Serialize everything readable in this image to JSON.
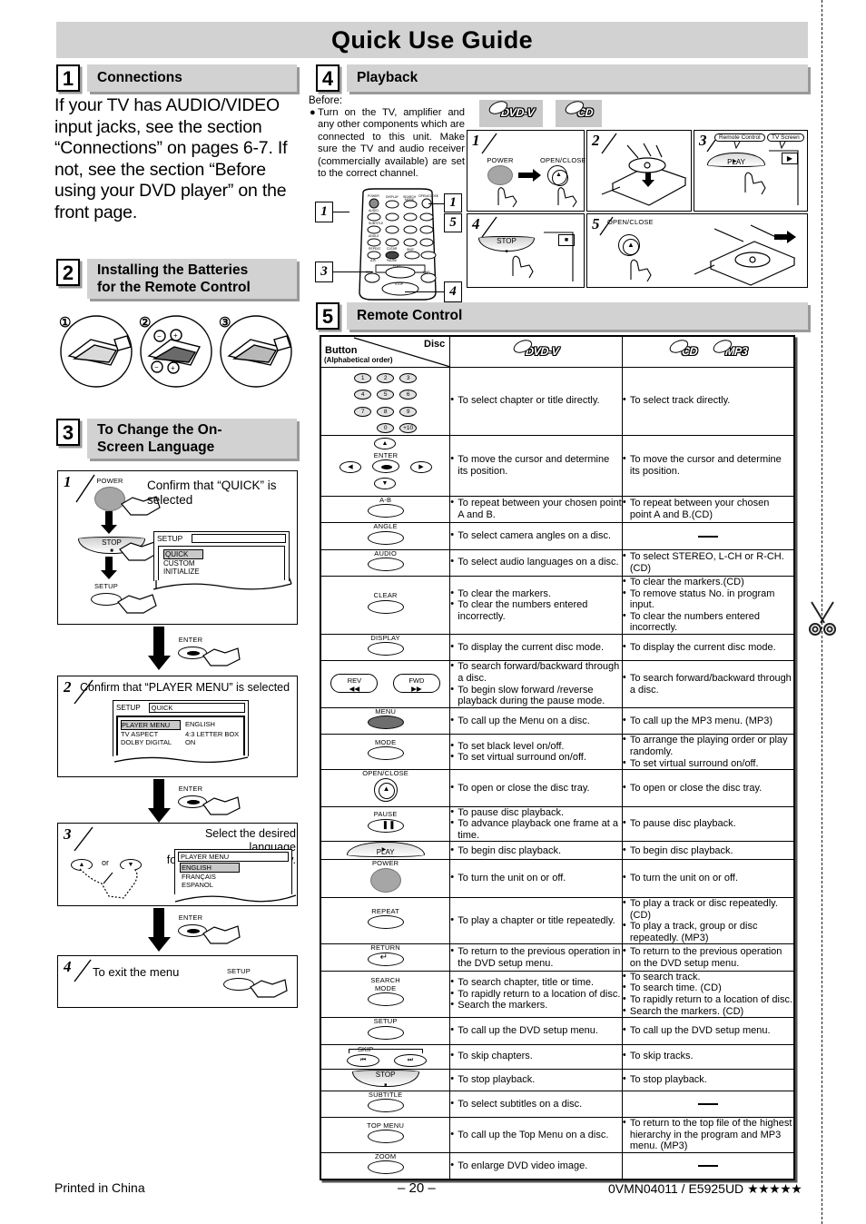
{
  "document": {
    "title": "Quick Use Guide",
    "footer": {
      "printed": "Printed in China",
      "page_number": "– 20 –",
      "part_number": "0VMN04011 / E5925UD",
      "stars": "★★★★★"
    }
  },
  "sections": {
    "connections": {
      "number": "1",
      "title": "Connections",
      "body": "If your TV has AUDIO/VIDEO input jacks, see the section “Connections” on pages 6-7. If not, see the section “Before using your DVD player” on the front page."
    },
    "batteries": {
      "number": "2",
      "title_line1": "Installing the Batteries",
      "title_line2": "for the Remote Control",
      "steps": [
        "①",
        "②",
        "③"
      ],
      "polarity": [
        "−",
        "+",
        "−",
        "+"
      ]
    },
    "language": {
      "number": "3",
      "title_line1": "To Change the On-",
      "title_line2": "Screen Language",
      "step1": {
        "num": "1",
        "instruction": "Confirm that “QUICK” is selected",
        "buttons": [
          "POWER",
          "STOP",
          "SETUP"
        ],
        "osd": {
          "header_left": "SETUP",
          "header_right": "",
          "items": [
            "QUICK",
            "CUSTOM",
            "INITIALIZE"
          ],
          "selected": "QUICK"
        }
      },
      "connector1_button": "ENTER",
      "step2": {
        "num": "2",
        "instruction": "Confirm that “PLAYER MENU” is selected",
        "osd": {
          "header_left": "SETUP",
          "header_right": "QUICK",
          "rows": [
            {
              "name": "PLAYER MENU",
              "value": "ENGLISH"
            },
            {
              "name": "TV ASPECT",
              "value": "4:3 LETTER BOX"
            },
            {
              "name": "DOLBY DIGITAL",
              "value": "ON"
            }
          ],
          "selected": "PLAYER MENU"
        }
      },
      "connector2_button": "ENTER",
      "step3": {
        "num": "3",
        "instruction_line1": "Select the desired language",
        "instruction_line2": "for the On-screen display.",
        "or_label": "or",
        "osd": {
          "header": "PLAYER MENU",
          "items": [
            "ENGLISH",
            "FRANÇAIS",
            "ESPANOL"
          ],
          "selected": "ENGLISH"
        }
      },
      "connector3_button": "ENTER",
      "step4": {
        "num": "4",
        "instruction": "To exit the menu",
        "button": "SETUP"
      }
    },
    "playback": {
      "number": "4",
      "title": "Playback",
      "before_label": "Before:",
      "before_text": "Turn on the TV, amplifier and any other components which are connected to this unit. Make sure the TV and audio receiver (commercially available) are set to the correct channel.",
      "disc_badges": [
        "DVD-V",
        "CD"
      ],
      "remote_callouts": [
        "1",
        "1",
        "5",
        "3",
        "4"
      ],
      "remote_labels": [
        "POWER",
        "DISPLAY",
        "SEARCH MODE",
        "OPEN/CLOSE",
        "AUDIO",
        "RETURN",
        "ANGLE",
        "REPEAT",
        "CLEAR",
        "A-B",
        "PAUSE",
        "SKIP",
        "PLAY",
        "REV",
        "FWD",
        "STOP"
      ],
      "steps": [
        {
          "num": "1",
          "labels": [
            "POWER",
            "OPEN/CLOSE"
          ]
        },
        {
          "num": "2",
          "labels": []
        },
        {
          "num": "3",
          "labels": [
            "PLAY"
          ],
          "callouts": [
            "Remote Control",
            "TV Screen"
          ]
        },
        {
          "num": "4",
          "labels": [
            "STOP"
          ]
        },
        {
          "num": "5",
          "labels": [
            "OPEN/CLOSE"
          ]
        }
      ]
    },
    "remote_control": {
      "number": "5",
      "title": "Remote Control"
    }
  },
  "remote_table": {
    "header": {
      "button_label": "Button",
      "button_sub": "(Alphabetical order)",
      "disc_label": "Disc",
      "col_dvd": "DVD-V",
      "col_cd": "CD",
      "col_mp3": "MP3"
    },
    "rows": [
      {
        "button": "numbers",
        "keys": [
          "1",
          "2",
          "3",
          "4",
          "5",
          "6",
          "7",
          "8",
          "9",
          "0",
          "+10"
        ],
        "dvd": [
          "To select chapter or title directly."
        ],
        "cd": [
          "To select track directly."
        ]
      },
      {
        "button": "cursor",
        "label": "ENTER",
        "dvd": [
          "To move the cursor and determine its position."
        ],
        "cd": [
          "To move the cursor and determine its position."
        ]
      },
      {
        "button": "A-B",
        "dvd": [
          "To repeat between your chosen point A and B."
        ],
        "cd": [
          "To repeat between your chosen point A and B.(CD)"
        ]
      },
      {
        "button": "ANGLE",
        "dvd": [
          "To select camera angles on a disc."
        ],
        "cd": null
      },
      {
        "button": "AUDIO",
        "dvd": [
          "To select audio languages on a disc."
        ],
        "cd": [
          "To select STEREO, L-CH or R-CH.(CD)"
        ]
      },
      {
        "button": "CLEAR",
        "dvd": [
          "To clear the markers.",
          "To clear the numbers entered incorrectly."
        ],
        "cd": [
          "To clear the markers.(CD)",
          "To remove status No. in program input.",
          "To clear the numbers entered incorrectly."
        ]
      },
      {
        "button": "DISPLAY",
        "dvd": [
          "To display the current disc mode."
        ],
        "cd": [
          "To display the current disc mode."
        ]
      },
      {
        "button": "REV/FWD",
        "label_left": "REV",
        "label_right": "FWD",
        "dvd": [
          "To search forward/backward through a disc.",
          "To begin slow forward /reverse playback during the pause mode."
        ],
        "cd": [
          "To search forward/backward through a disc."
        ]
      },
      {
        "button": "MENU",
        "dvd": [
          "To call up the Menu on a disc."
        ],
        "cd": [
          "To call up the MP3 menu. (MP3)"
        ]
      },
      {
        "button": "MODE",
        "dvd": [
          "To set black level on/off.",
          "To set virtual surround on/off."
        ],
        "cd": [
          "To arrange the playing order or play randomly.",
          "To set virtual surround on/off."
        ]
      },
      {
        "button": "OPEN/CLOSE",
        "dvd": [
          "To open or close the disc tray."
        ],
        "cd": [
          "To open or close the disc tray."
        ]
      },
      {
        "button": "PAUSE",
        "dvd": [
          "To pause disc playback.",
          "To advance playback one frame at a time."
        ],
        "cd": [
          "To pause disc playback."
        ]
      },
      {
        "button": "PLAY",
        "dvd": [
          "To begin disc playback."
        ],
        "cd": [
          "To begin disc playback."
        ]
      },
      {
        "button": "POWER",
        "dvd": [
          "To turn the unit on or off."
        ],
        "cd": [
          "To turn the unit on or off."
        ]
      },
      {
        "button": "REPEAT",
        "dvd": [
          "To play a chapter or title repeatedly."
        ],
        "cd": [
          "To play a track or disc repeatedly. (CD)",
          "To play a track, group or disc repeatedly. (MP3)"
        ]
      },
      {
        "button": "RETURN",
        "dvd": [
          "To return to the previous operation in the DVD setup menu."
        ],
        "cd": [
          "To return to the previous operation on the DVD setup menu."
        ]
      },
      {
        "button": "SEARCH MODE",
        "label_line1": "SEARCH",
        "label_line2": "MODE",
        "dvd": [
          "To search chapter, title or time.",
          "To rapidly return to a location of disc.",
          "Search the markers."
        ],
        "cd": [
          "To search track.",
          "To search time. (CD)",
          "To rapidly return to a location of disc.",
          "Search the markers. (CD)"
        ]
      },
      {
        "button": "SETUP",
        "dvd": [
          "To call up the DVD setup menu."
        ],
        "cd": [
          "To call up the DVD setup menu."
        ]
      },
      {
        "button": "SKIP",
        "dvd": [
          "To skip chapters."
        ],
        "cd": [
          "To skip tracks."
        ]
      },
      {
        "button": "STOP",
        "dvd": [
          "To stop playback."
        ],
        "cd": [
          "To stop playback."
        ]
      },
      {
        "button": "SUBTITLE",
        "dvd": [
          "To select subtitles on a disc."
        ],
        "cd": null
      },
      {
        "button": "TOP MENU",
        "dvd": [
          "To call up the Top Menu on a disc."
        ],
        "cd": [
          "To return to the top file of the highest hierarchy in the program and MP3 menu. (MP3)"
        ]
      },
      {
        "button": "ZOOM",
        "dvd": [
          "To enlarge DVD video image."
        ],
        "cd": null
      }
    ]
  },
  "colors": {
    "header_gray": "#d2d2d2",
    "shadow_gray": "#9a9a9a",
    "button_gray": "#a6a6a6"
  }
}
